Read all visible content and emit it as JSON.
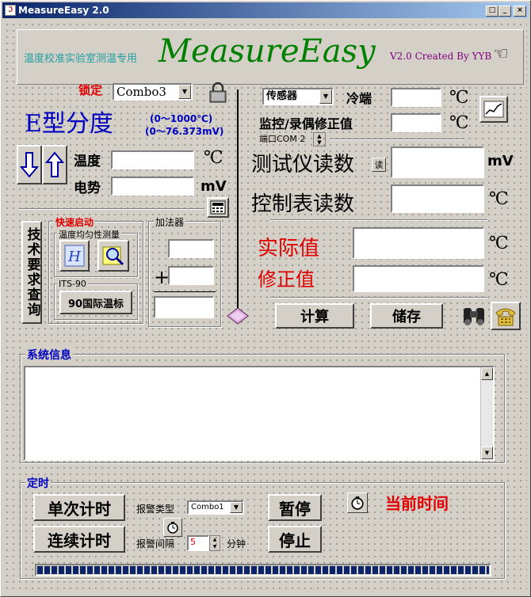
{
  "window": {
    "title": "MeasureEasy 2.0",
    "min": "_",
    "max": "□",
    "close": "×"
  },
  "header": {
    "subtitle": "温度校准实验室测温专用",
    "brand": "MeasureEasy",
    "credit": "V2.0 Created By YYB"
  },
  "lock": {
    "label": "锁定",
    "combo": "Combo3"
  },
  "thermo": {
    "type": "E型分度",
    "range1": "(0～1000℃)",
    "range2": "(0～76.373mV)"
  },
  "inputs": {
    "temp_label": "温度",
    "temp_unit": "℃",
    "emf_label": "电势",
    "emf_unit": "mV"
  },
  "quick": {
    "title": "快速启动",
    "uniform": "温度均匀性测量",
    "its": "ITS-90",
    "its_button": "90国际温标"
  },
  "tech": {
    "label": "技术要求查询"
  },
  "adder": {
    "title": "加法器",
    "plus": "+"
  },
  "sensor": {
    "combo": "传感器",
    "cold_label": "冷端",
    "cold_unit": "℃",
    "monitor_label": "监控/录偶修正值",
    "monitor_unit": "℃",
    "port": "端口COM 2"
  },
  "readings": {
    "tester_label": "测试仪读数",
    "tester_btn": "读",
    "tester_unit": "mV",
    "control_label": "控制表读数",
    "control_unit": "℃",
    "actual_label": "实际值",
    "actual_unit": "℃",
    "correction_label": "修正值",
    "correction_unit": "℃"
  },
  "actions": {
    "calc": "计算",
    "save": "储存"
  },
  "sysinfo": {
    "title": "系统信息"
  },
  "timer": {
    "title": "定时",
    "single": "单次计时",
    "continuous": "连续计时",
    "alarm_type_label": "报警类型",
    "alarm_combo": "Combo1",
    "alarm_interval_label": "报警间隔",
    "interval_value": "5",
    "interval_unit": "分钟",
    "pause": "暂停",
    "stop": "停止",
    "now_label": "当前时间"
  },
  "colors": {
    "brand": "#008000",
    "accent_red": "#e00000",
    "accent_blue": "#0000c0",
    "progress": "#0a246a"
  }
}
